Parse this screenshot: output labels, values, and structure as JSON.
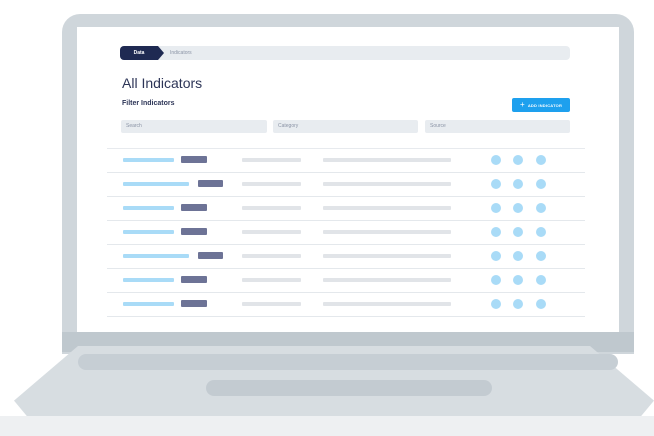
{
  "breadcrumb": {
    "active": "Data",
    "next": "Indicators"
  },
  "page": {
    "title": "All Indicators",
    "filter_title": "Filter Indicators"
  },
  "add_button": {
    "label": "ADD INDICATOR",
    "icon": "plus-icon"
  },
  "filters": [
    {
      "id": "search",
      "placeholder": "Search"
    },
    {
      "id": "category",
      "placeholder": "Category"
    },
    {
      "id": "source",
      "placeholder": "Source"
    }
  ],
  "colors": {
    "primary": "#1ea0ee",
    "navy": "#1f2a52",
    "placeholder_blue": "#a9dbf7",
    "placeholder_gray": "#e1e4e8",
    "tag": "#6d7396"
  },
  "table": {
    "row_count": 7
  }
}
